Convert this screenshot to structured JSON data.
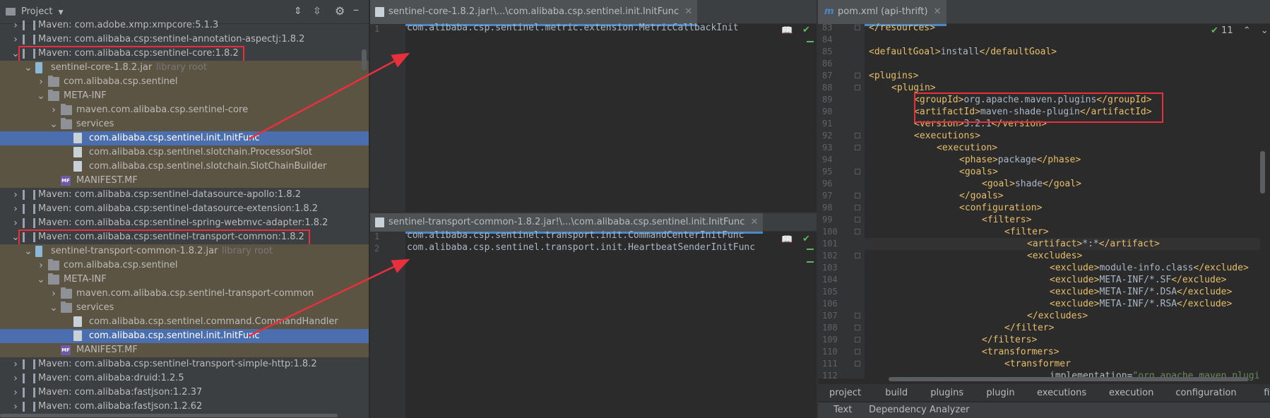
{
  "project_panel": {
    "title": "Project",
    "tree": [
      {
        "label": "Maven: com.adobe.xmp:xmpcore:5.1.3",
        "indent": 0,
        "arrow": ">",
        "icon": "library-icon"
      },
      {
        "label": "Maven: com.alibaba.csp:sentinel-annotation-aspectj:1.8.2",
        "indent": 0,
        "arrow": ">",
        "icon": "library-icon"
      },
      {
        "label": "Maven: com.alibaba.csp:sentinel-core:1.8.2",
        "indent": 0,
        "arrow": "v",
        "icon": "library-icon",
        "boxed": true
      },
      {
        "label": "sentinel-core-1.8.2.jar",
        "hint": "library root",
        "indent": 1,
        "arrow": "v",
        "icon": "jar-icon",
        "highlight": true
      },
      {
        "label": "com.alibaba.csp.sentinel",
        "indent": 2,
        "arrow": ">",
        "icon": "folder-icon",
        "highlight": true
      },
      {
        "label": "META-INF",
        "indent": 2,
        "arrow": "v",
        "icon": "folder-icon",
        "highlight": true
      },
      {
        "label": "maven.com.alibaba.csp.sentinel-core",
        "indent": 3,
        "arrow": ">",
        "icon": "folder-icon",
        "highlight": true
      },
      {
        "label": "services",
        "indent": 3,
        "arrow": "v",
        "icon": "folder-icon",
        "highlight": true
      },
      {
        "label": "com.alibaba.csp.sentinel.init.InitFunc",
        "indent": 4,
        "arrow": "",
        "icon": "file-icon",
        "selected": true
      },
      {
        "label": "com.alibaba.csp.sentinel.slotchain.ProcessorSlot",
        "indent": 4,
        "arrow": "",
        "icon": "file-icon",
        "highlight": true
      },
      {
        "label": "com.alibaba.csp.sentinel.slotchain.SlotChainBuilder",
        "indent": 4,
        "arrow": "",
        "icon": "file-icon",
        "highlight": true
      },
      {
        "label": "MANIFEST.MF",
        "indent": 3,
        "arrow": "",
        "icon": "manifest-icon",
        "highlight": true
      },
      {
        "label": "Maven: com.alibaba.csp:sentinel-datasource-apollo:1.8.2",
        "indent": 0,
        "arrow": ">",
        "icon": "library-icon"
      },
      {
        "label": "Maven: com.alibaba.csp:sentinel-datasource-extension:1.8.2",
        "indent": 0,
        "arrow": ">",
        "icon": "library-icon"
      },
      {
        "label": "Maven: com.alibaba.csp:sentinel-spring-webmvc-adapter:1.8.2",
        "indent": 0,
        "arrow": ">",
        "icon": "library-icon"
      },
      {
        "label": "Maven: com.alibaba.csp:sentinel-transport-common:1.8.2",
        "indent": 0,
        "arrow": "v",
        "icon": "library-icon",
        "boxed": true
      },
      {
        "label": "sentinel-transport-common-1.8.2.jar",
        "hint": "library root",
        "indent": 1,
        "arrow": "v",
        "icon": "jar-icon",
        "highlight": true
      },
      {
        "label": "com.alibaba.csp.sentinel",
        "indent": 2,
        "arrow": ">",
        "icon": "folder-icon",
        "highlight": true
      },
      {
        "label": "META-INF",
        "indent": 2,
        "arrow": "v",
        "icon": "folder-icon",
        "highlight": true
      },
      {
        "label": "maven.com.alibaba.csp.sentinel-transport-common",
        "indent": 3,
        "arrow": ">",
        "icon": "folder-icon",
        "highlight": true
      },
      {
        "label": "services",
        "indent": 3,
        "arrow": "v",
        "icon": "folder-icon",
        "highlight": true
      },
      {
        "label": "com.alibaba.csp.sentinel.command.CommandHandler",
        "indent": 4,
        "arrow": "",
        "icon": "file-icon",
        "highlight": true
      },
      {
        "label": "com.alibaba.csp.sentinel.init.InitFunc",
        "indent": 4,
        "arrow": "",
        "icon": "file-icon",
        "selected": true
      },
      {
        "label": "MANIFEST.MF",
        "indent": 3,
        "arrow": "",
        "icon": "manifest-icon",
        "highlight": true
      },
      {
        "label": "Maven: com.alibaba.csp:sentinel-transport-simple-http:1.8.2",
        "indent": 0,
        "arrow": ">",
        "icon": "library-icon"
      },
      {
        "label": "Maven: com.alibaba:druid:1.2.5",
        "indent": 0,
        "arrow": ">",
        "icon": "library-icon"
      },
      {
        "label": "Maven: com.alibaba:fastjson:1.2.37",
        "indent": 0,
        "arrow": ">",
        "icon": "library-icon"
      },
      {
        "label": "Maven: com.alibaba:fastjson:1.2.62",
        "indent": 0,
        "arrow": ">",
        "icon": "library-icon"
      }
    ]
  },
  "editor_top": {
    "tab_label": "sentinel-core-1.8.2.jar!\\...\\com.alibaba.csp.sentinel.init.InitFunc",
    "lines": [
      {
        "num": "1",
        "text": "com.alibaba.csp.sentinel.metric.extension.MetricCallbackInit"
      }
    ]
  },
  "editor_bottom": {
    "tab_label": "sentinel-transport-common-1.8.2.jar!\\...\\com.alibaba.csp.sentinel.init.InitFunc",
    "lines": [
      {
        "num": "1",
        "text": "com.alibaba.csp.sentinel.transport.init.CommandCenterInitFunc"
      },
      {
        "num": "2",
        "text": "com.alibaba.csp.sentinel.transport.init.HeartbeatSenderInitFunc"
      }
    ]
  },
  "editor_pom": {
    "tab_label": "pom.xml (api-thrift)",
    "tab_icon_letter": "m",
    "inspection_count": "11",
    "lines": [
      {
        "num": "83",
        "indent": 0,
        "tag": "</resources>",
        "text": ""
      },
      {
        "num": "84",
        "indent": 0,
        "tag": "",
        "text": ""
      },
      {
        "num": "85",
        "indent": 0,
        "tag": "<defaultGoal>",
        "text": "install",
        "close": "</defaultGoal>"
      },
      {
        "num": "86",
        "indent": 0,
        "tag": "",
        "text": ""
      },
      {
        "num": "87",
        "indent": 0,
        "tag": "<plugins>",
        "text": ""
      },
      {
        "num": "88",
        "indent": 1,
        "tag": "<plugin>",
        "text": ""
      },
      {
        "num": "89",
        "indent": 2,
        "tag": "<groupId>",
        "text": "org.apache.maven.plugins",
        "close": "</groupId>"
      },
      {
        "num": "90",
        "indent": 2,
        "tag": "<artifactId>",
        "text": "maven-shade-plugin",
        "close": "</artifactId>"
      },
      {
        "num": "91",
        "indent": 2,
        "tag": "<version>",
        "text": "3.2.1",
        "close": "</version>"
      },
      {
        "num": "92",
        "indent": 2,
        "tag": "<executions>",
        "text": ""
      },
      {
        "num": "93",
        "indent": 3,
        "tag": "<execution>",
        "text": ""
      },
      {
        "num": "94",
        "indent": 4,
        "tag": "<phase>",
        "text": "package",
        "close": "</phase>"
      },
      {
        "num": "95",
        "indent": 4,
        "tag": "<goals>",
        "text": ""
      },
      {
        "num": "96",
        "indent": 5,
        "tag": "<goal>",
        "text": "shade",
        "close": "</goal>"
      },
      {
        "num": "97",
        "indent": 4,
        "tag": "</goals>",
        "text": ""
      },
      {
        "num": "98",
        "indent": 4,
        "tag": "<configuration>",
        "text": ""
      },
      {
        "num": "99",
        "indent": 5,
        "tag": "<filters>",
        "text": ""
      },
      {
        "num": "100",
        "indent": 6,
        "tag": "<filter>",
        "text": ""
      },
      {
        "num": "101",
        "indent": 7,
        "tag": "<artifact>",
        "text": "*:*",
        "close": "</artifact>",
        "current": true
      },
      {
        "num": "102",
        "indent": 7,
        "tag": "<excludes>",
        "text": ""
      },
      {
        "num": "103",
        "indent": 8,
        "tag": "<exclude>",
        "text": "module-info.class",
        "close": "</exclude>"
      },
      {
        "num": "104",
        "indent": 8,
        "tag": "<exclude>",
        "text": "META-INF/*.SF",
        "close": "</exclude>"
      },
      {
        "num": "105",
        "indent": 8,
        "tag": "<exclude>",
        "text": "META-INF/*.DSA",
        "close": "</exclude>"
      },
      {
        "num": "106",
        "indent": 8,
        "tag": "<exclude>",
        "text": "META-INF/*.RSA",
        "close": "</exclude>"
      },
      {
        "num": "107",
        "indent": 7,
        "tag": "</excludes>",
        "text": ""
      },
      {
        "num": "108",
        "indent": 6,
        "tag": "</filter>",
        "text": ""
      },
      {
        "num": "109",
        "indent": 5,
        "tag": "</filters>",
        "text": ""
      },
      {
        "num": "110",
        "indent": 5,
        "tag": "<transformers>",
        "text": ""
      },
      {
        "num": "111",
        "indent": 6,
        "tag": "<transformer",
        "text": ""
      },
      {
        "num": "112",
        "indent": 8,
        "attr": "implementation",
        "str": "\"org.apache.maven.plugi"
      }
    ],
    "breadcrumbs": [
      "project",
      "build",
      "plugins",
      "plugin",
      "executions",
      "execution",
      "configuration",
      "filters"
    ],
    "bottom_tabs": [
      "Text",
      "Dependency Analyzer"
    ]
  },
  "colors": {
    "highlight_box": "#e8303c",
    "selection": "#4b6eaf",
    "tree_highlight": "#5c5442"
  }
}
